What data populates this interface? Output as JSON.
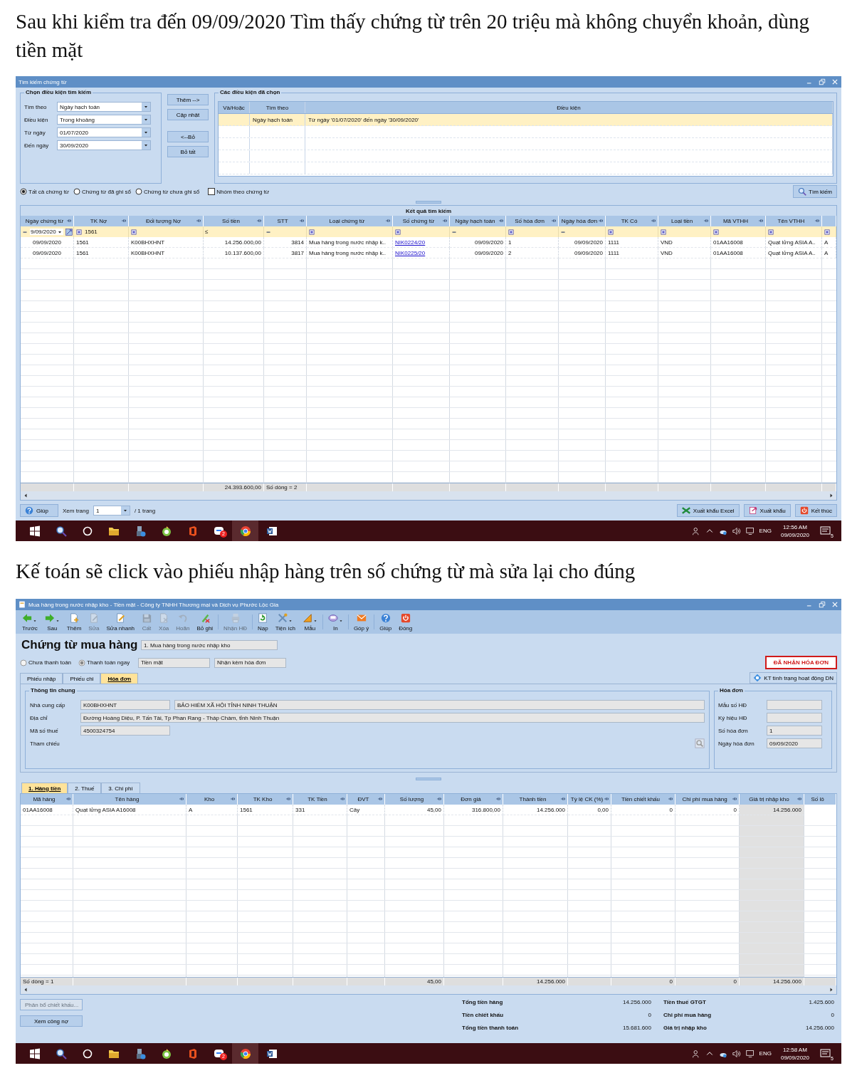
{
  "headings": [
    "Sau khi kiểm tra đến 09/09/2020 Tìm thấy chứng từ trên 20 triệu mà không chuyển khoản, dùng tiền mặt",
    "Kế toán sẽ click vào phiếu nhập hàng trên số chứng từ mà sửa lại cho đúng"
  ],
  "search_window": {
    "title": "Tìm kiếm chứng từ",
    "criteria": {
      "title": "Chọn điều kiện tìm kiếm",
      "fields": [
        {
          "label": "Tìm theo",
          "value": "Ngày hạch toán"
        },
        {
          "label": "Điều kiện",
          "value": "Trong khoảng"
        },
        {
          "label": "Từ ngày",
          "value": "01/07/2020"
        },
        {
          "label": "Đến ngày",
          "value": "30/09/2020"
        }
      ]
    },
    "actions": [
      "Thêm -->",
      "Cập nhật",
      "<--Bỏ",
      "Bỏ tất"
    ],
    "chosen": {
      "title": "Các điều kiện đã chọn",
      "columns": [
        "Và/Hoặc",
        "Tìm theo",
        "Điều kiện"
      ],
      "rows": [
        {
          "selected": true,
          "search_by": "Ngày hạch toán",
          "condition": "Từ ngày '01/07/2020' đến ngày '30/09/2020'"
        }
      ]
    },
    "scope": [
      {
        "label": "Tất cả chứng từ",
        "selected": true
      },
      {
        "label": "Chứng từ đã ghi sổ",
        "selected": false
      },
      {
        "label": "Chứng từ chưa ghi sổ",
        "selected": false
      }
    ],
    "group_by": {
      "label": "Nhóm theo chứng từ",
      "checked": false
    },
    "search_button": "Tìm kiếm",
    "results": {
      "title": "Kết quả tìm kiếm",
      "columns": [
        "Ngày chứng từ",
        "TK Nợ",
        "Đối tượng Nợ",
        "Số tiền",
        "STT",
        "Loại chứng từ",
        "Số chứng từ",
        "Ngày hạch toán",
        "Số hóa đơn",
        "Ngày hóa đơn",
        "TK Có",
        "Loại tiền",
        "Mã VTHH",
        "Tên VTHH"
      ],
      "filters": [
        {
          "kind": "date",
          "text": "9/09/2020"
        },
        {
          "kind": "box",
          "text": "1561"
        },
        {
          "kind": "box"
        },
        {
          "kind": "op",
          "text": "≤"
        },
        {
          "kind": "dash"
        },
        {
          "kind": "box"
        },
        {
          "kind": "box"
        },
        {
          "kind": "dash"
        },
        {
          "kind": "box"
        },
        {
          "kind": "dash"
        },
        {
          "kind": "box"
        },
        {
          "kind": "box"
        },
        {
          "kind": "box"
        },
        {
          "kind": "box"
        },
        {
          "kind": "box"
        }
      ],
      "rows": [
        {
          "cells": [
            "09/09/2020",
            "1561",
            "K00BHXHNT",
            "14.256.000,00",
            "3814",
            "Mua hàng trong nước nhập k..",
            "NIK0224/20",
            "09/09/2020",
            "1",
            "09/09/2020",
            "1111",
            "VND",
            "01AA16008",
            "Quạt lửng ASIA A..",
            "A"
          ]
        },
        {
          "cells": [
            "09/09/2020",
            "1561",
            "K00BHXHNT",
            "10.137.600,00",
            "3817",
            "Mua hàng trong nước nhập k..",
            "NIK0225/20",
            "09/09/2020",
            "2",
            "09/09/2020",
            "1111",
            "VND",
            "01AA16008",
            "Quạt lửng ASIA A..",
            "A"
          ]
        }
      ],
      "summary": {
        "amount_total": "24.393.600,00",
        "row_count": "Số dòng = 2"
      }
    },
    "footer_bar": {
      "help": "Giúp",
      "page_label": "Xem trang",
      "page": "1",
      "page_total": "/ 1 trang",
      "buttons": [
        "Xuất khẩu Excel",
        "Xuất khẩu",
        "Kết thúc"
      ]
    },
    "taskbar": {
      "badge": "2",
      "lang": "ENG",
      "time": "12:56 AM",
      "date": "09/09/2020",
      "notifications": "5"
    }
  },
  "voucher_window": {
    "title": "Mua hàng trong nước nhập kho - Tiền mặt - Công ty TNHH Thương mại và Dịch vụ Phước Lộc Gia",
    "toolbar": [
      {
        "label": "Trước",
        "disabled": false,
        "dropdown": true
      },
      {
        "label": "Sau",
        "disabled": false,
        "dropdown": true
      },
      {
        "label": "Thêm",
        "disabled": false,
        "dropdown": false
      },
      {
        "label": "Sửa",
        "disabled": true,
        "dropdown": false
      },
      {
        "label": "Sửa nhanh",
        "disabled": false,
        "dropdown": false
      },
      {
        "label": "Cất",
        "disabled": true,
        "dropdown": false
      },
      {
        "label": "Xóa",
        "disabled": true,
        "dropdown": false
      },
      {
        "label": "Hoãn",
        "disabled": true,
        "dropdown": false
      },
      {
        "label": "Bỏ ghi",
        "disabled": false,
        "dropdown": false
      },
      {
        "label": "Nhận HĐ",
        "disabled": true,
        "dropdown": false
      },
      {
        "label": "Nạp",
        "disabled": false,
        "dropdown": false
      },
      {
        "label": "Tiện ích",
        "disabled": false,
        "dropdown": true
      },
      {
        "label": "Mẫu",
        "disabled": false,
        "dropdown": true
      },
      {
        "label": "In",
        "disabled": false,
        "dropdown": true
      },
      {
        "label": "Góp ý",
        "disabled": false,
        "dropdown": false
      },
      {
        "label": "Giúp",
        "disabled": false,
        "dropdown": false
      },
      {
        "label": "Đóng",
        "disabled": false,
        "dropdown": false
      }
    ],
    "heading": "Chứng từ mua hàng",
    "voucher_type": "1. Mua hàng trong nước nhập kho",
    "payment": [
      {
        "label": "Chưa thanh toán",
        "selected": false
      },
      {
        "label": "Thanh toán ngay",
        "selected": true
      }
    ],
    "payment_method": "Tiền mặt",
    "invoice_mode": "Nhận kèm hóa đơn",
    "status_badge": "ĐÃ NHẬN HÓA ĐƠN",
    "tabs": [
      {
        "label": "Phiếu nhập",
        "selected": false
      },
      {
        "label": "Phiếu chi",
        "selected": false
      },
      {
        "label": "Hóa đơn",
        "selected": true
      }
    ],
    "check_button": "KT tình trạng hoạt động DN",
    "general": {
      "title": "Thông tin chung",
      "supplier_label": "Nhà cung cấp",
      "supplier_code": "K00BHXHNT",
      "supplier_name": "BẢO HIỂM XÃ HỘI TỈNH NINH THUẬN",
      "address_label": "Địa chỉ",
      "address": "Đường Hoàng Diệu, P. Tấn Tài, Tp Phan Rang - Tháp Chàm, tỉnh Ninh Thuận",
      "tax_label": "Mã số thuế",
      "tax_code": "4500324754",
      "reference_label": "Tham chiếu"
    },
    "invoice": {
      "title": "Hóa đơn",
      "fields": [
        {
          "label": "Mẫu số HĐ"
        },
        {
          "label": "Ký hiệu HĐ"
        },
        {
          "label": "Số hóa đơn",
          "value": "1"
        },
        {
          "label": "Ngày hóa đơn",
          "value": "09/09/2020"
        }
      ]
    },
    "detail_tabs": [
      {
        "label": "1. Hàng tiền",
        "selected": true
      },
      {
        "label": "2. Thuế",
        "selected": false
      },
      {
        "label": "3. Chi phí",
        "selected": false
      }
    ],
    "grid": {
      "columns": [
        "Mã hàng",
        "Tên hàng",
        "Kho",
        "TK Kho",
        "TK Tiền",
        "ĐVT",
        "Số lượng",
        "Đơn giá",
        "Thành tiền",
        "Tỷ lệ CK (%)",
        "Tiền chiết khấu",
        "Chi phí mua hàng",
        "Giá trị nhập kho",
        "Số lô"
      ],
      "rows": [
        {
          "cells": [
            "01AA16008",
            "Quạt lửng ASIA A16008",
            "A",
            "1561",
            "331",
            "Cây",
            "45,00",
            "316.800,00",
            "14.256.000",
            "0,00",
            "0",
            "0",
            "14.256.000"
          ]
        }
      ],
      "summary": {
        "row_count": "Số dòng = 1",
        "quantity_total": "45,00",
        "amount_total": "14.256.000",
        "discount_total": "0",
        "purchase_cost_total": "0",
        "stock_value_total": "14.256.000"
      }
    },
    "buttons": [
      {
        "label": "Phân bổ chiết khấu...",
        "disabled": true
      },
      {
        "label": "Xem công nợ",
        "disabled": false
      }
    ],
    "totals": [
      {
        "label": "Tổng tiền hàng",
        "value": "14.256.000"
      },
      {
        "label": "Tiền thuế GTGT",
        "value": "1.425.600"
      },
      {
        "label": "Tiền chiết khấu",
        "value": "0"
      },
      {
        "label": "Chi phí mua hàng",
        "value": "0"
      },
      {
        "label": "Tổng tiền thanh toán",
        "value": "15.681.600"
      },
      {
        "label": "Giá trị nhập kho",
        "value": "14.256.000"
      }
    ],
    "taskbar": {
      "badge": "2",
      "lang": "ENG",
      "time": "12:58 AM",
      "date": "09/09/2020",
      "notifications": "5"
    }
  }
}
